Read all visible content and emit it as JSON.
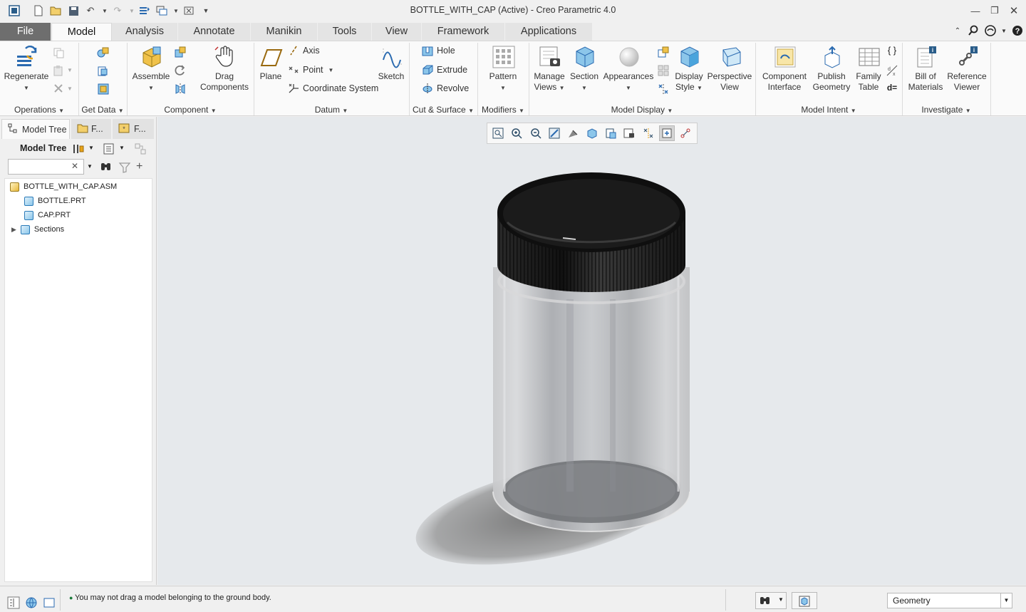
{
  "window": {
    "title": "BOTTLE_WITH_CAP (Active) - Creo Parametric 4.0"
  },
  "tabs": [
    "File",
    "Model",
    "Analysis",
    "Annotate",
    "Manikin",
    "Tools",
    "View",
    "Framework",
    "Applications"
  ],
  "active_tab": "Model",
  "ribbon": {
    "regenerate": "Regenerate",
    "assemble": "Assemble",
    "drag_components": [
      "Drag",
      "Components"
    ],
    "plane": "Plane",
    "axis": "Axis",
    "point": "Point",
    "coordinate_system": "Coordinate System",
    "sketch": "Sketch",
    "hole": "Hole",
    "extrude": "Extrude",
    "revolve": "Revolve",
    "pattern": "Pattern",
    "manage_views": [
      "Manage",
      "Views"
    ],
    "section": "Section",
    "appearances": "Appearances",
    "display_style": [
      "Display",
      "Style"
    ],
    "perspective_view": [
      "Perspective",
      "View"
    ],
    "component_interface": [
      "Component",
      "Interface"
    ],
    "publish_geometry": [
      "Publish",
      "Geometry"
    ],
    "family_table": [
      "Family",
      "Table"
    ],
    "bill_of_materials": [
      "Bill of",
      "Materials"
    ],
    "reference_viewer": [
      "Reference",
      "Viewer"
    ],
    "groups": {
      "operations": "Operations",
      "get_data": "Get Data",
      "component": "Component",
      "datum": "Datum",
      "cut_surface": "Cut & Surface",
      "modifiers": "Modifiers",
      "model_display": "Model Display",
      "model_intent": "Model Intent",
      "investigate": "Investigate"
    }
  },
  "left_panel": {
    "tabs": [
      "Model Tree",
      "F...",
      "F..."
    ],
    "header": "Model Tree",
    "search_placeholder": "",
    "tree": [
      {
        "label": "BOTTLE_WITH_CAP.ASM"
      },
      {
        "label": "BOTTLE.PRT"
      },
      {
        "label": "CAP.PRT"
      },
      {
        "label": "Sections"
      }
    ]
  },
  "status": {
    "message": "You may not drag a model belonging to the ground body.",
    "filter": "Geometry"
  },
  "colors": {
    "file_tab": "#6e6e6e",
    "ribbon_bg": "#fafafa",
    "graphics_bg": "#e6e9ec",
    "cap": "#1b1b1b"
  }
}
